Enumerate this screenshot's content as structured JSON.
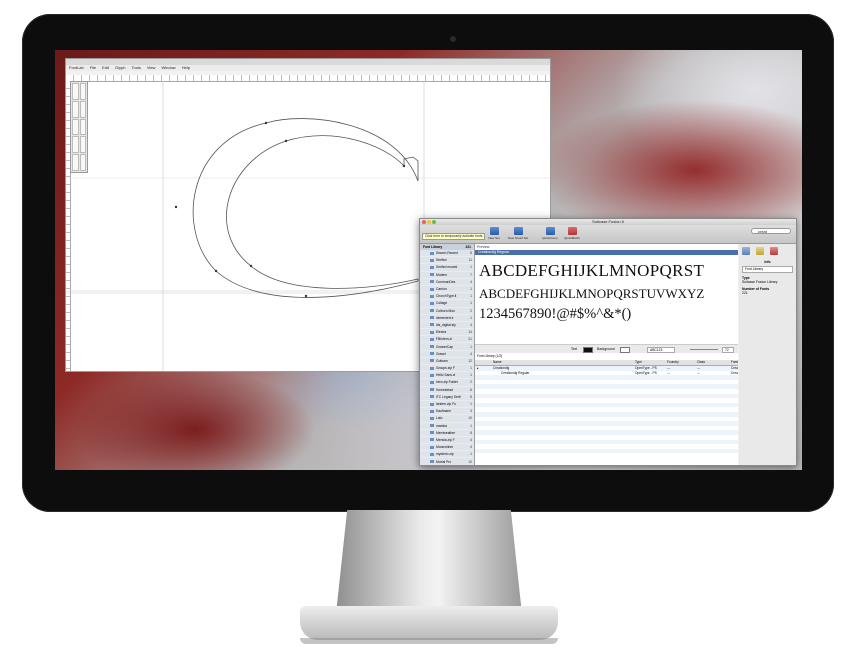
{
  "editor": {
    "menu": [
      "FontLab",
      "File",
      "Edit",
      "Glyph",
      "Tools",
      "View",
      "Window",
      "Help"
    ]
  },
  "fusion": {
    "title": "Suitcase Fusion 5",
    "tooltip": "Click here to temporarily activate fonts",
    "toolbar": [
      "New Set",
      "New Smart Set",
      "QuickComp",
      "QuickMatch"
    ],
    "search_value": "creat",
    "sidebar_header": "Font Library",
    "sidebar_header_count": "221",
    "sidebar_items": [
      {
        "name": "Search Recent",
        "count": "8"
      },
      {
        "name": "Serifed",
        "count": "11"
      },
      {
        "name": "Serifed moved",
        "count": "1"
      },
      {
        "name": "Modern",
        "count": "7"
      },
      {
        "name": "CommonDes",
        "count": "4"
      },
      {
        "name": "Carrion",
        "count": "1"
      },
      {
        "name": "ChurchType.it",
        "count": "1"
      },
      {
        "name": "Collage",
        "count": "1"
      },
      {
        "name": "Colburn.Mon",
        "count": "2"
      },
      {
        "name": "demented.e",
        "count": "1"
      },
      {
        "name": "dis_digital.sty",
        "count": "4"
      },
      {
        "name": "Electra",
        "count": "14"
      },
      {
        "name": "FBIntern.zi",
        "count": "21"
      },
      {
        "name": "GrowerCap",
        "count": "1"
      },
      {
        "name": "Gravel",
        "count": "4"
      },
      {
        "name": "Gotham",
        "count": "12"
      },
      {
        "name": "Groups.zip F",
        "count": "1"
      },
      {
        "name": "Hello Sans.zi",
        "count": "1"
      },
      {
        "name": "hero.zip Folder",
        "count": "2"
      },
      {
        "name": "Homestead",
        "count": "6"
      },
      {
        "name": "ITC Legacy Serif",
        "count": "8"
      },
      {
        "name": "lantern.zip Fo",
        "count": "1"
      },
      {
        "name": "Kaufmann",
        "count": "3"
      },
      {
        "name": "Lato",
        "count": "10"
      },
      {
        "name": "mamba",
        "count": "1"
      },
      {
        "name": "Merriweather",
        "count": "8"
      },
      {
        "name": "Mensla.zip F",
        "count": "4"
      },
      {
        "name": "Moonshiner",
        "count": "4"
      },
      {
        "name": "mysterio.zip",
        "count": "1"
      },
      {
        "name": "Mortal Pro",
        "count": "10"
      },
      {
        "name": "Novecento",
        "count": "6"
      },
      {
        "name": "odd_serif.gat",
        "count": "1"
      },
      {
        "name": "Open_Sans",
        "count": "10"
      },
      {
        "name": "Paris Seller",
        "count": "4"
      }
    ],
    "preview_label": "Preview",
    "preview_font": "Creationdlg Regular",
    "preview_lines": [
      "ABCDEFGHIJKLMNOPQRST",
      "ABCDEFGHIJKLMNOPQRSTUVWXYZ",
      "1234567890!@#$%^&*()"
    ],
    "options": {
      "text": "Text",
      "background": "Background",
      "sample": "ABC123",
      "size": "72"
    },
    "table_label": "Font Library (1/2)",
    "table_headers": [
      "Name",
      "Type",
      "Foundry",
      "Class",
      "Family"
    ],
    "table_rows": [
      {
        "name": "Creationdlg",
        "type": "OpenType - PS",
        "foundry": "---",
        "class": "---",
        "family": "Creationdlg"
      },
      {
        "name": "Creationdlg Regular",
        "type": "OpenType - PS",
        "foundry": "---",
        "class": "---",
        "family": "Creationdlg"
      }
    ],
    "info": {
      "header": "Info",
      "select": "Font Library",
      "type_key": "Type",
      "type_val": "Suitcase Fusion Library",
      "num_key": "Number of Fonts",
      "num_val": "221"
    }
  }
}
